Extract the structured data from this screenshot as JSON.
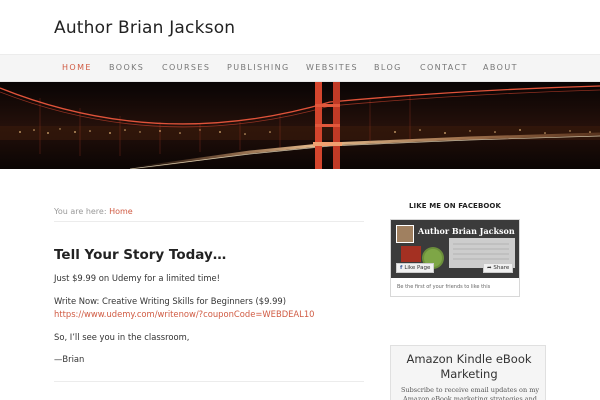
{
  "site": {
    "title": "Author Brian Jackson"
  },
  "nav": {
    "items": [
      {
        "label": "HOME",
        "active": true
      },
      {
        "label": "BOOKS"
      },
      {
        "label": "COURSES"
      },
      {
        "label": "PUBLISHING"
      },
      {
        "label": "WEBSITES"
      },
      {
        "label": "BLOG"
      },
      {
        "label": "CONTACT"
      },
      {
        "label": "ABOUT"
      }
    ]
  },
  "breadcrumb": {
    "prefix": "You are here: ",
    "current": "Home"
  },
  "post": {
    "title": "Tell Your Story Today…",
    "line1": "Just $9.99 on Udemy for a limited time!",
    "line2": "Write Now: Creative Writing Skills for Beginners ($9.99)",
    "link": "https://www.udemy.com/writenow/?couponCode=WEBDEAL10",
    "line3": "So, I’ll see you in the classroom,",
    "signoff": "—Brian"
  },
  "sidebar": {
    "facebook": {
      "title": "LIKE ME ON FACEBOOK",
      "page_name": "Author Brian Jackson",
      "like_label": "Like Page",
      "share_label": "Share",
      "friends_text": "Be the first of your friends to like this"
    },
    "kindle": {
      "title": "Amazon Kindle eBook Marketing",
      "text": "Subscribe to receive email updates on my Amazon eBook marketing strategies and tips"
    }
  },
  "colors": {
    "accent": "#d05b43",
    "nav_bg": "#f5f5f5"
  }
}
